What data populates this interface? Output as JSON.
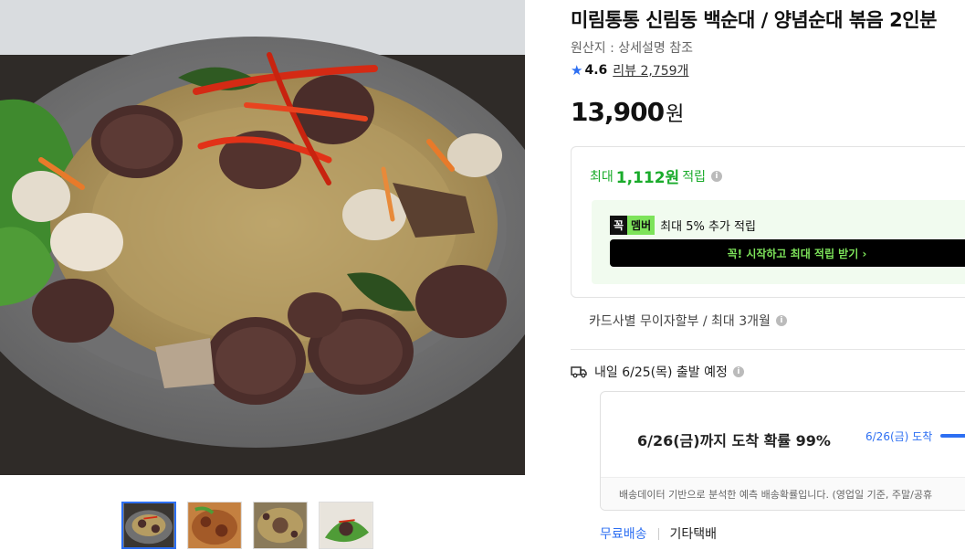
{
  "product": {
    "title": "미림통통 신림동 백순대 / 양념순대 볶음 2인분",
    "origin": "원산지 : 상세설명 참조",
    "rating": "4.6",
    "reviews": "리뷰 2,759개",
    "price": "13,900",
    "price_unit": "원"
  },
  "reward": {
    "max_prefix": "최대",
    "max_amount": "1,112원",
    "max_suffix": "적립",
    "badge_k": "꼭",
    "badge_m": "멤버",
    "member_text": "최대 5% 추가 적립",
    "member_button": "꼭! 시작하고 최대 적립 받기 ›"
  },
  "installment": "카드사별 무이자할부 / 최대 3개월",
  "shipping": {
    "departure": "내일 6/25(목) 출발 예정",
    "probability": "6/26(금)까지 도착 확률 99%",
    "arrive_label": "6/26(금) 도착",
    "note": "배송데이터 기반으로 분석한 예측 배송확률입니다. (영업일 기준, 주말/공휴",
    "free": "무료배송",
    "other": "기타택배"
  },
  "colors": {
    "accent_blue": "#2d6ff2",
    "reward_green": "#1aab2b",
    "member_green": "#7de35a"
  },
  "icons": {
    "rating": "star-icon",
    "info": "info-icon",
    "truck": "truck-icon"
  }
}
